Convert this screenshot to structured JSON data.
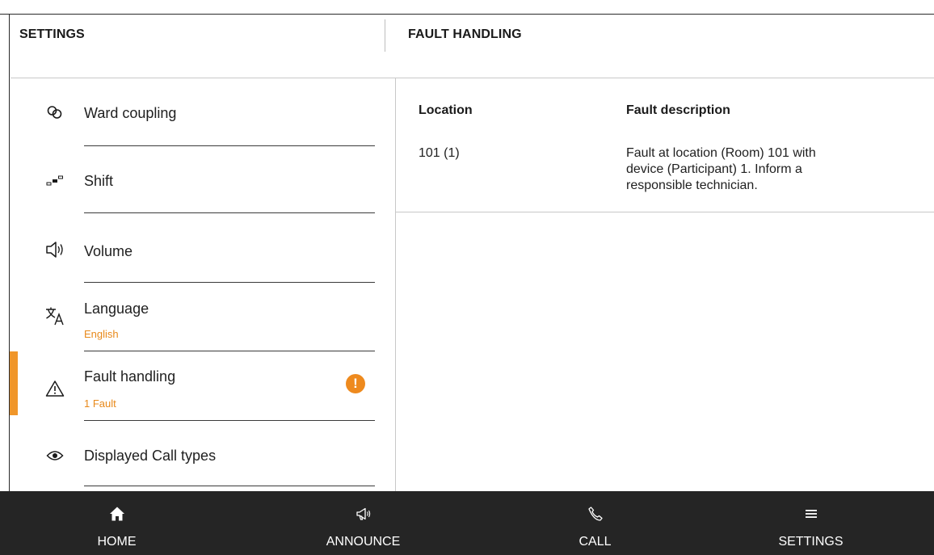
{
  "header": {
    "settings_title": "SETTINGS",
    "detail_title": "FAULT HANDLING"
  },
  "menu": [
    {
      "label": "Ward coupling",
      "sub": "",
      "icon": "link-icon"
    },
    {
      "label": "Shift",
      "sub": "",
      "icon": "shift-icon"
    },
    {
      "label": "Volume",
      "sub": "",
      "icon": "speaker-icon"
    },
    {
      "label": "Language",
      "sub": "English",
      "icon": "translate-icon"
    },
    {
      "label": "Fault handling",
      "sub": "1 Fault",
      "icon": "warning-icon",
      "active": true,
      "badge": "!"
    },
    {
      "label": "Displayed Call types",
      "sub": "",
      "icon": "eye-icon"
    }
  ],
  "faults": {
    "columns": [
      "Location",
      "Fault description"
    ],
    "rows": [
      {
        "location": "101 (1)",
        "description_lines": [
          "Fault at location (Room) 101 with",
          "device (Participant) 1. Inform a",
          "responsible technician."
        ]
      }
    ]
  },
  "nav": [
    {
      "label": "HOME",
      "icon": "home-icon"
    },
    {
      "label": "ANNOUNCE",
      "icon": "megaphone-icon"
    },
    {
      "label": "CALL",
      "icon": "phone-icon"
    },
    {
      "label": "SETTINGS",
      "icon": "menu-icon"
    }
  ],
  "colors": {
    "accent": "#f0962a",
    "badge": "#ee8a1e",
    "bottom_bar": "#252525"
  }
}
